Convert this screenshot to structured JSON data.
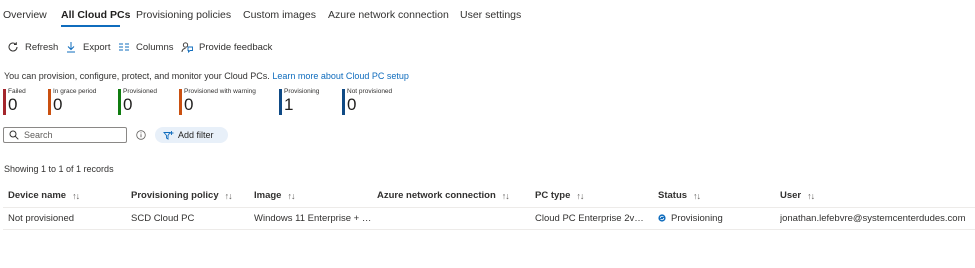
{
  "tabs": [
    {
      "label": "Overview",
      "active": false
    },
    {
      "label": "All Cloud PCs",
      "active": true
    },
    {
      "label": "Provisioning policies",
      "active": false
    },
    {
      "label": "Custom images",
      "active": false
    },
    {
      "label": "Azure network connection",
      "active": false
    },
    {
      "label": "User settings",
      "active": false
    }
  ],
  "toolbar": {
    "refresh": "Refresh",
    "export": "Export",
    "columns": "Columns",
    "feedback": "Provide feedback"
  },
  "info": {
    "text": "You can provision, configure, protect, and monitor your Cloud PCs.",
    "link": "Learn more about Cloud PC setup"
  },
  "tiles": [
    {
      "label": "Failed",
      "value": "0",
      "color": "#a4262c"
    },
    {
      "label": "In grace period",
      "value": "0",
      "color": "#ca5010"
    },
    {
      "label": "Provisioned",
      "value": "0",
      "color": "#107c10"
    },
    {
      "label": "Provisioned with warning",
      "value": "0",
      "color": "#ca5010"
    },
    {
      "label": "Provisioning",
      "value": "1",
      "color": "#0f4a85"
    },
    {
      "label": "Not provisioned",
      "value": "0",
      "color": "#0f4a85"
    }
  ],
  "search": {
    "placeholder": "Search"
  },
  "filter": {
    "label": "Add filter"
  },
  "records": "Showing 1 to 1 of 1 records",
  "table": {
    "columns": [
      "Device name",
      "Provisioning policy",
      "Image",
      "Azure network connection",
      "PC type",
      "Status",
      "User"
    ],
    "sort_glyph": "↑↓",
    "rows": [
      {
        "device_name": "Not provisioned",
        "policy": "SCD Cloud PC",
        "image": "Windows 11 Enterprise + M...",
        "network": "",
        "pc_type": "Cloud PC Enterprise 2vCPU...",
        "status": "Provisioning",
        "user": "jonathan.lefebvre@systemcenterdudes.com"
      }
    ]
  }
}
